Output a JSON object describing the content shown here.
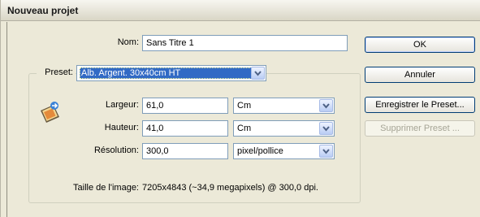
{
  "window": {
    "title": "Nouveau projet"
  },
  "form": {
    "name_label": "Nom:",
    "name_value": "Sans Titre 1",
    "preset_label": "Preset:",
    "preset_value": "Alb. Argent. 30x40cm HT",
    "width_label": "Largeur:",
    "width_value": "61,0",
    "width_unit": "Cm",
    "height_label": "Hauteur:",
    "height_value": "41,0",
    "height_unit": "Cm",
    "resolution_label": "Résolution:",
    "resolution_value": "300,0",
    "resolution_unit": "pixel/pollice",
    "image_size_label": "Taille de l'image:",
    "image_size_value": "7205x4843 (~34,9 megapixels) @ 300,0 dpi."
  },
  "buttons": {
    "ok": "OK",
    "cancel": "Annuler",
    "save_preset": "Enregistrer le Preset...",
    "delete_preset": "Supprimer Preset ..."
  },
  "icons": {
    "photo": "photo-resize-icon",
    "dropdown": "chevron-down-icon"
  }
}
